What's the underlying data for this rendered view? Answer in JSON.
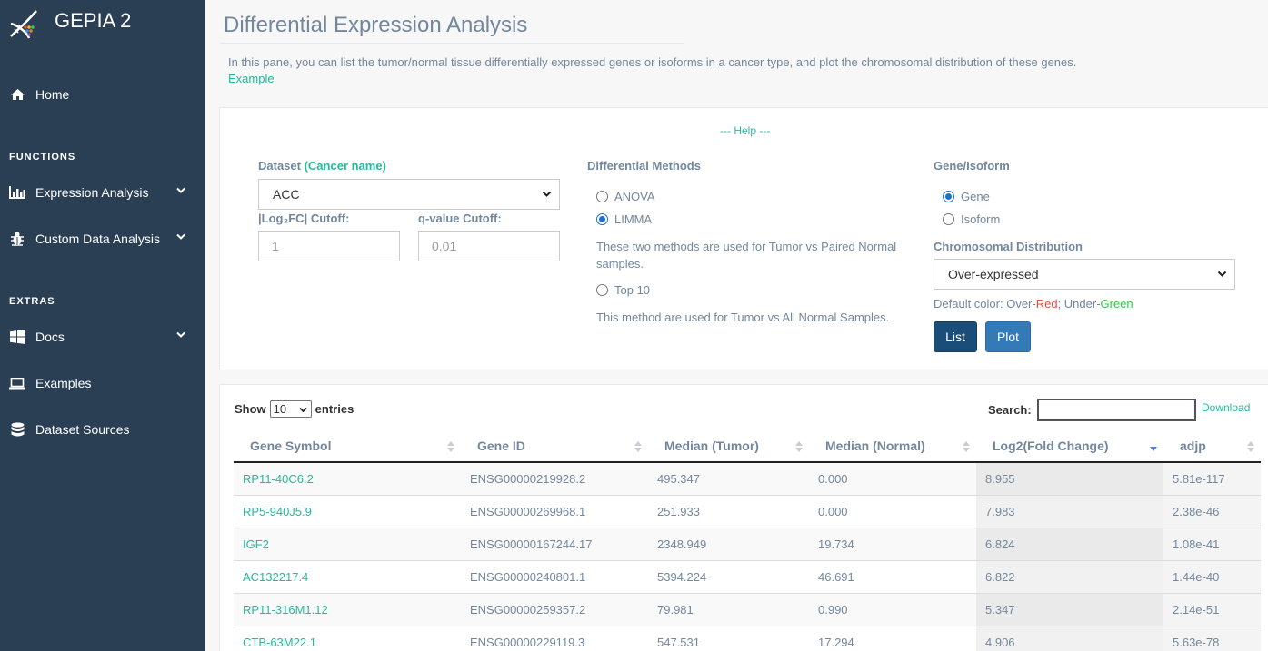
{
  "app": {
    "name": "GEPIA 2"
  },
  "sidebar": {
    "home": "Home",
    "functions_title": "FUNCTIONS",
    "extras_title": "EXTRAS",
    "items": [
      {
        "label": "Expression Analysis",
        "icon": "bar-chart-icon"
      },
      {
        "label": "Custom Data Analysis",
        "icon": "bug-icon"
      },
      {
        "label": "Docs",
        "icon": "windows-icon"
      },
      {
        "label": "Examples",
        "icon": "laptop-icon"
      },
      {
        "label": "Dataset Sources",
        "icon": "database-icon"
      }
    ]
  },
  "page": {
    "title": "Differential Expression Analysis",
    "intro": "In this pane, you can list the tumor/normal tissue differentially expressed genes or isoforms in a cancer type, and plot the chromosomal distribution of these genes.",
    "example": "Example"
  },
  "form": {
    "help": "--- Help ---",
    "dataset_label": "Dataset",
    "dataset_accent": "(Cancer name)",
    "dataset_value": "ACC",
    "log2fc_label": "|Log₂FC| Cutoff:",
    "log2fc_value": "1",
    "qvalue_label": "q-value Cutoff:",
    "qvalue_value": "0.01",
    "methods_label": "Differential Methods",
    "method_anova": "ANOVA",
    "method_limma": "LIMMA",
    "methods_note": "These two methods are used for Tumor vs Paired Normal samples.",
    "method_top10": "Top 10",
    "top10_note": "This method are used for Tumor vs All Normal Samples.",
    "gene_isoform_label": "Gene/Isoform",
    "opt_gene": "Gene",
    "opt_isoform": "Isoform",
    "chrom_label": "Chromosomal Distribution",
    "chrom_value": "Over-expressed",
    "color_prefix": "Default color: Over-",
    "color_red": "Red",
    "color_mid": "; Under-",
    "color_green": "Green",
    "btn_list": "List",
    "btn_plot": "Plot"
  },
  "table": {
    "show_label": "Show",
    "entries_value": "10",
    "entries_label": "entries",
    "search_label": "Search:",
    "download": "Download",
    "columns": [
      "Gene Symbol",
      "Gene ID",
      "Median (Tumor)",
      "Median (Normal)",
      "Log2(Fold Change)",
      "adjp"
    ],
    "rows": [
      [
        "RP11-40C6.2",
        "ENSG00000219928.2",
        "495.347",
        "0.000",
        "8.955",
        "5.81e-117"
      ],
      [
        "RP5-940J5.9",
        "ENSG00000269968.1",
        "251.933",
        "0.000",
        "7.983",
        "2.38e-46"
      ],
      [
        "IGF2",
        "ENSG00000167244.17",
        "2348.949",
        "19.734",
        "6.824",
        "1.08e-41"
      ],
      [
        "AC132217.4",
        "ENSG00000240801.1",
        "5394.224",
        "46.691",
        "6.822",
        "1.44e-40"
      ],
      [
        "RP11-316M1.12",
        "ENSG00000259357.2",
        "79.981",
        "0.990",
        "5.347",
        "2.14e-51"
      ],
      [
        "CTB-63M22.1",
        "ENSG00000229119.3",
        "547.531",
        "17.294",
        "4.906",
        "5.63e-78"
      ]
    ]
  },
  "colors": {
    "sidebar": "#2a3f54",
    "accent": "#26b99a",
    "text": "#73879c",
    "btn_list": "#1a4d78",
    "btn_plot": "#337ab7"
  }
}
